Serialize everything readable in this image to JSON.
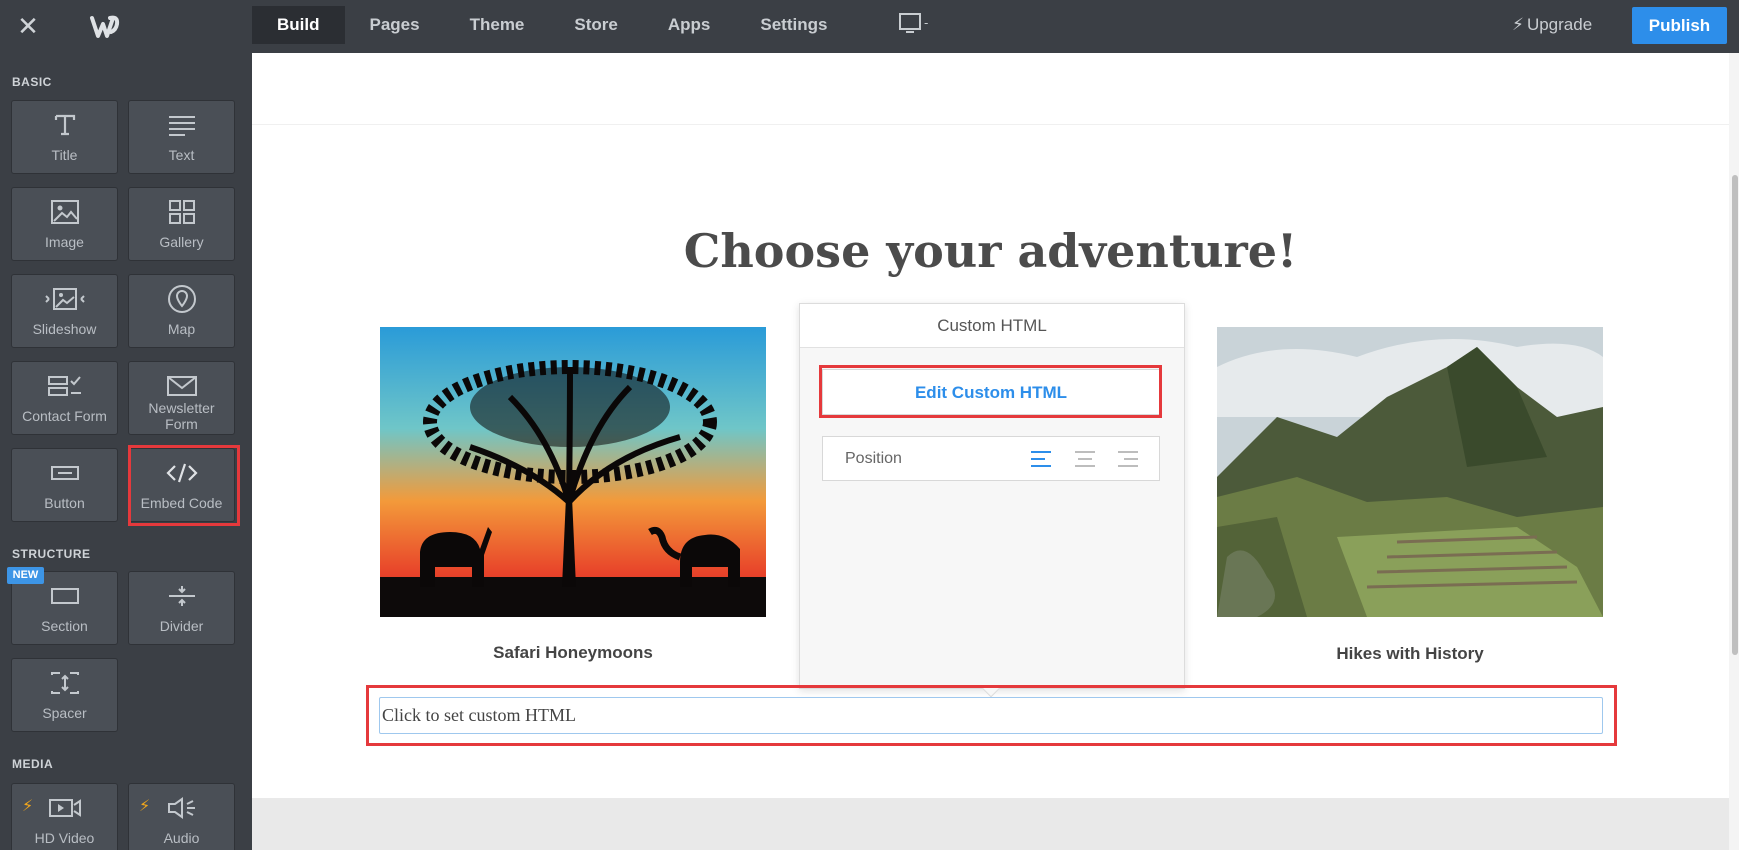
{
  "topbar": {
    "nav": [
      "Build",
      "Pages",
      "Theme",
      "Store",
      "Apps",
      "Settings"
    ],
    "device_suffix": "-",
    "upgrade": "Upgrade",
    "publish": "Publish"
  },
  "sidebar": {
    "sections": {
      "basic": "BASIC",
      "structure": "STRUCTURE",
      "media": "MEDIA"
    },
    "new_badge": "NEW",
    "tiles": {
      "title": "Title",
      "text": "Text",
      "image": "Image",
      "gallery": "Gallery",
      "slideshow": "Slideshow",
      "map": "Map",
      "contact_form": "Contact Form",
      "newsletter_form_1": "Newsletter",
      "newsletter_form_2": "Form",
      "button": "Button",
      "embed_code": "Embed Code",
      "section": "Section",
      "divider": "Divider",
      "spacer": "Spacer",
      "hd_video": "HD Video",
      "audio": "Audio"
    }
  },
  "page": {
    "heading": "Choose your adventure!",
    "captions": {
      "left": "Safari Honeymoons",
      "right": "Hikes with History"
    },
    "custom_html_placeholder": "Click to set custom HTML"
  },
  "popup": {
    "title": "Custom HTML",
    "edit_button": "Edit Custom HTML",
    "position_label": "Position"
  },
  "colors": {
    "accent": "#2d8eea",
    "highlight": "#e5393c",
    "bolt": "#f2a71b"
  }
}
